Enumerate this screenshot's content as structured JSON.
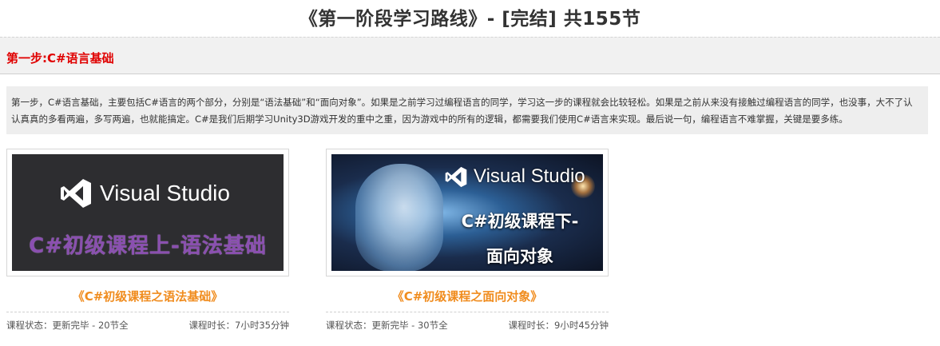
{
  "page": {
    "title": "《第一阶段学习路线》- [完结] 共155节"
  },
  "step": {
    "title": "第一步:C#语言基础",
    "description": "第一步，C#语言基础，主要包括C#语言的两个部分，分别是“语法基础”和“面向对象”。如果是之前学习过编程语言的同学，学习这一步的课程就会比较轻松。如果是之前从来没有接触过编程语言的同学，也没事，大不了认认真真的多看两遍，多写两遍，也就能搞定。C#是我们后期学习Unity3D游戏开发的重中之重，因为游戏中的所有的逻辑，都需要我们使用C#语言来实现。最后说一句，编程语言不难掌握，关键是要多练。"
  },
  "courses": [
    {
      "thumbnail": {
        "logo_text": "Visual Studio",
        "banner": "C#初级课程上-语法基础",
        "logo_icon": "visual-studio-logo-icon"
      },
      "title": "《C#初级课程之语法基础》",
      "status": "课程状态：更新完毕 - 20节全",
      "duration": "课程时长：7小时35分钟"
    },
    {
      "thumbnail": {
        "logo_text": "Visual Studio",
        "banner_line1": "C#初级课程下-",
        "banner_line2": "面向对象",
        "logo_icon": "visual-studio-logo-icon"
      },
      "title": "《C#初级课程之面向对象》",
      "status": "课程状态：更新完毕 - 30节全",
      "duration": "课程时长：9小时45分钟"
    }
  ],
  "colors": {
    "step_title": "#e00000",
    "course_link": "#f08c1e",
    "banner_purple": "#8a4fb0"
  }
}
